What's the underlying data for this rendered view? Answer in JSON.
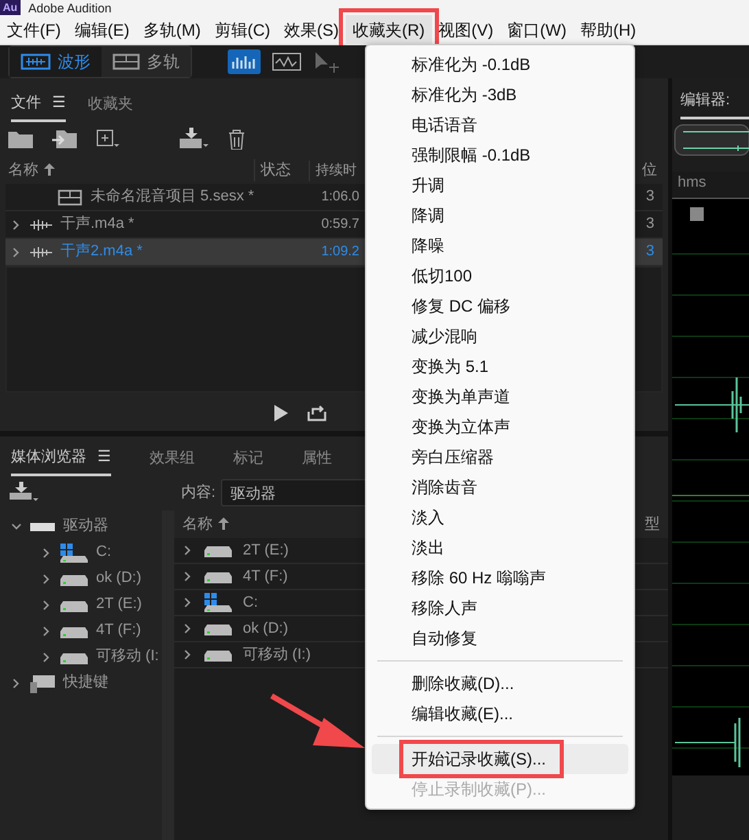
{
  "window": {
    "title": "Adobe Audition",
    "app_icon": "Au"
  },
  "menubar": [
    {
      "label": "文件(F)",
      "selected": false,
      "annotated": false
    },
    {
      "label": "编辑(E)",
      "selected": false,
      "annotated": false
    },
    {
      "label": "多轨(M)",
      "selected": false,
      "annotated": false
    },
    {
      "label": "剪辑(C)",
      "selected": false,
      "annotated": false
    },
    {
      "label": "效果(S)",
      "selected": false,
      "annotated": false
    },
    {
      "label": "收藏夹(R)",
      "selected": true,
      "annotated": true
    },
    {
      "label": "视图(V)",
      "selected": false,
      "annotated": false
    },
    {
      "label": "窗口(W)",
      "selected": false,
      "annotated": false
    },
    {
      "label": "帮助(H)",
      "selected": false,
      "annotated": false
    }
  ],
  "toolbar": {
    "modes": [
      {
        "label": "波形",
        "kind": "waveform",
        "selected": true
      },
      {
        "label": "多轨",
        "kind": "multitrack",
        "selected": false
      }
    ]
  },
  "files_panel": {
    "tabs": [
      {
        "label": "文件",
        "selected": true,
        "menu": "☰"
      },
      {
        "label": "收藏夹",
        "selected": false
      }
    ],
    "columns": [
      "名称",
      "状态",
      "持续时",
      "位"
    ],
    "rows": [
      {
        "kind": "session",
        "name": "未命名混音项目 5.sesx *",
        "duration": "1:06.0",
        "column_4": "3",
        "selected": false
      },
      {
        "kind": "audio",
        "name": "干声.m4a *",
        "duration": "0:59.7",
        "column_4": "3",
        "selected": false
      },
      {
        "kind": "audio",
        "name": "干声2.m4a *",
        "duration": "1:09.2",
        "column_4": "3",
        "selected": true
      }
    ]
  },
  "media_panel": {
    "tabs": [
      {
        "label": "媒体浏览器",
        "selected": true,
        "menu": "☰"
      },
      {
        "label": "效果组",
        "selected": false
      },
      {
        "label": "标记",
        "selected": false
      },
      {
        "label": "属性",
        "selected": false
      }
    ],
    "content_label": "内容:",
    "content_value": "驱动器",
    "tree": [
      {
        "label": "驱动器",
        "kind": "drives",
        "expanded": true,
        "children": [
          {
            "label": "C:",
            "kind": "system"
          },
          {
            "label": "ok (D:)",
            "kind": "drive"
          },
          {
            "label": "2T (E:)",
            "kind": "drive"
          },
          {
            "label": "4T (F:)",
            "kind": "drive"
          },
          {
            "label": "可移动 (I:",
            "kind": "drive"
          }
        ]
      },
      {
        "label": "快捷键",
        "kind": "shortcuts",
        "expanded": false
      }
    ],
    "list_columns": [
      "名称",
      "型"
    ],
    "list": [
      {
        "label": "2T (E:)",
        "kind": "drive"
      },
      {
        "label": "4T (F:)",
        "kind": "drive"
      },
      {
        "label": "C:",
        "kind": "system"
      },
      {
        "label": "ok (D:)",
        "kind": "drive"
      },
      {
        "label": "可移动 (I:)",
        "kind": "drive"
      }
    ]
  },
  "editor": {
    "title": "编辑器:",
    "ruler_label": "hms"
  },
  "favorites_menu": [
    {
      "kind": "item",
      "label": "标准化为 -0.1dB",
      "selected": false,
      "disabled": false,
      "annotated": false
    },
    {
      "kind": "item",
      "label": "标准化为 -3dB",
      "selected": false,
      "disabled": false,
      "annotated": false
    },
    {
      "kind": "item",
      "label": "电话语音",
      "selected": false,
      "disabled": false,
      "annotated": false
    },
    {
      "kind": "item",
      "label": "强制限幅 -0.1dB",
      "selected": false,
      "disabled": false,
      "annotated": false
    },
    {
      "kind": "item",
      "label": "升调",
      "selected": false,
      "disabled": false,
      "annotated": false
    },
    {
      "kind": "item",
      "label": "降调",
      "selected": false,
      "disabled": false,
      "annotated": false
    },
    {
      "kind": "item",
      "label": "降噪",
      "selected": false,
      "disabled": false,
      "annotated": false
    },
    {
      "kind": "item",
      "label": "低切100",
      "selected": false,
      "disabled": false,
      "annotated": false
    },
    {
      "kind": "item",
      "label": "修复 DC 偏移",
      "selected": false,
      "disabled": false,
      "annotated": false
    },
    {
      "kind": "item",
      "label": "减少混响",
      "selected": false,
      "disabled": false,
      "annotated": false
    },
    {
      "kind": "item",
      "label": "变换为 5.1",
      "selected": false,
      "disabled": false,
      "annotated": false
    },
    {
      "kind": "item",
      "label": "变换为单声道",
      "selected": false,
      "disabled": false,
      "annotated": false
    },
    {
      "kind": "item",
      "label": "变换为立体声",
      "selected": false,
      "disabled": false,
      "annotated": false
    },
    {
      "kind": "item",
      "label": "旁白压缩器",
      "selected": false,
      "disabled": false,
      "annotated": false
    },
    {
      "kind": "item",
      "label": "消除齿音",
      "selected": false,
      "disabled": false,
      "annotated": false
    },
    {
      "kind": "item",
      "label": "淡入",
      "selected": false,
      "disabled": false,
      "annotated": false
    },
    {
      "kind": "item",
      "label": "淡出",
      "selected": false,
      "disabled": false,
      "annotated": false
    },
    {
      "kind": "item",
      "label": "移除 60 Hz 嗡嗡声",
      "selected": false,
      "disabled": false,
      "annotated": false
    },
    {
      "kind": "item",
      "label": "移除人声",
      "selected": false,
      "disabled": false,
      "annotated": false
    },
    {
      "kind": "item",
      "label": "自动修复",
      "selected": false,
      "disabled": false,
      "annotated": false
    },
    {
      "kind": "separator"
    },
    {
      "kind": "item",
      "label": "删除收藏(D)...",
      "selected": false,
      "disabled": false,
      "annotated": false
    },
    {
      "kind": "item",
      "label": "编辑收藏(E)...",
      "selected": false,
      "disabled": false,
      "annotated": false
    },
    {
      "kind": "separator"
    },
    {
      "kind": "item",
      "label": "开始记录收藏(S)...",
      "selected": true,
      "disabled": false,
      "annotated": true
    },
    {
      "kind": "item",
      "label": "停止录制收藏(P)...",
      "selected": false,
      "disabled": true,
      "annotated": false
    }
  ]
}
